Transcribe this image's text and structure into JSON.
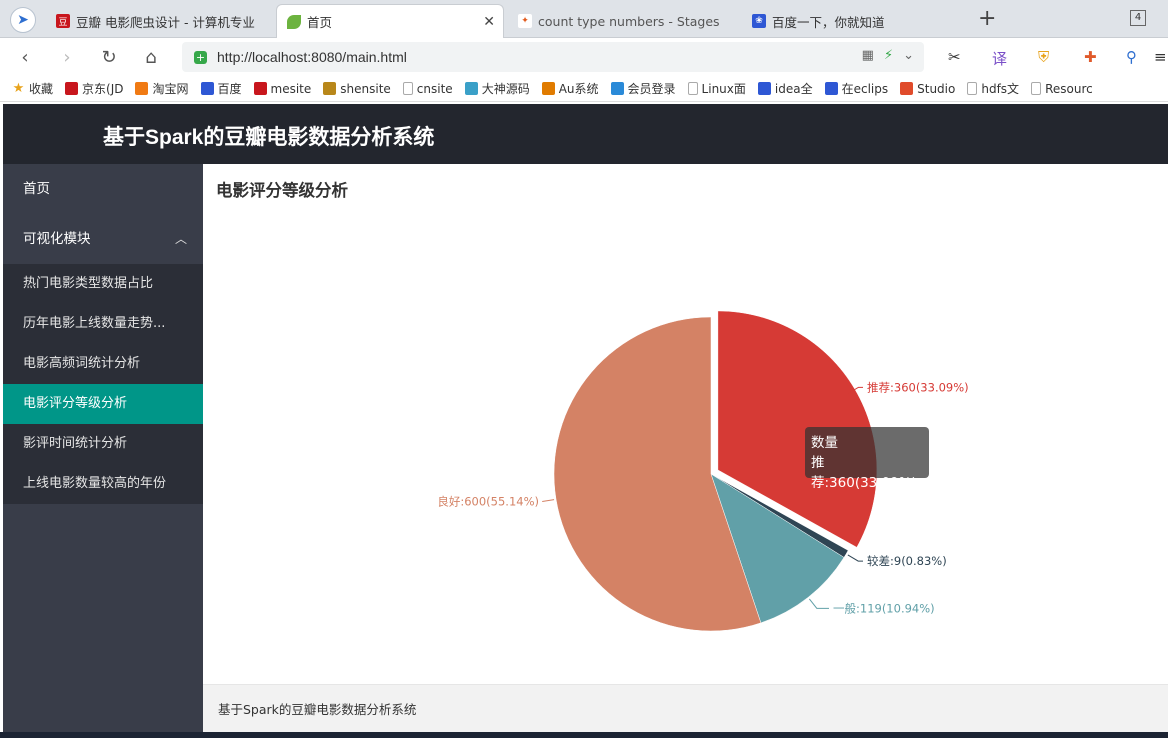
{
  "browser": {
    "tabs": [
      {
        "title": "豆瓣 电影爬虫设计 - 计算机专业",
        "favicon": "douban",
        "active": false
      },
      {
        "title": "首页",
        "favicon": "leaf",
        "active": true
      },
      {
        "title": "count type numbers - Stages",
        "favicon": "spark",
        "active": false
      },
      {
        "title": "百度一下，你就知道",
        "favicon": "baidu",
        "active": false
      }
    ],
    "tab_count": "4",
    "url": "http://localhost:8080/main.html",
    "bookmarks": [
      {
        "label": "收藏",
        "icon": "star",
        "color": "#e8a31c"
      },
      {
        "label": "京东(JD",
        "icon": "jd",
        "color": "#c8161d"
      },
      {
        "label": "淘宝网",
        "icon": "taobao",
        "color": "#f07a13"
      },
      {
        "label": "百度",
        "icon": "paw",
        "color": "#2e57d4"
      },
      {
        "label": "mesite",
        "icon": "mesite",
        "color": "#c8161d"
      },
      {
        "label": "shensite",
        "icon": "grid",
        "color": "#b8871a"
      },
      {
        "label": "cnsite",
        "icon": "doc",
        "color": "#aaaaaa"
      },
      {
        "label": "大神源码",
        "icon": "swirl",
        "color": "#3aa0c8"
      },
      {
        "label": "Au系统",
        "icon": "au",
        "color": "#e07b00"
      },
      {
        "label": "会员登录",
        "icon": "cloud",
        "color": "#2a8ad8"
      },
      {
        "label": "Linux面",
        "icon": "doc",
        "color": "#aaaaaa"
      },
      {
        "label": "idea全",
        "icon": "paw",
        "color": "#2e57d4"
      },
      {
        "label": "在eclips",
        "icon": "paw",
        "color": "#2e57d4"
      },
      {
        "label": "Studio",
        "icon": "studio",
        "color": "#e04b2b"
      },
      {
        "label": "hdfs文",
        "icon": "doc",
        "color": "#aaaaaa"
      },
      {
        "label": "Resourc",
        "icon": "doc",
        "color": "#aaaaaa"
      }
    ]
  },
  "app": {
    "title": "基于Spark的豆瓣电影数据分析系统",
    "sidebar": {
      "home": "首页",
      "group": "可视化模块",
      "items": [
        {
          "label": "热门电影类型数据占比",
          "active": false
        },
        {
          "label": "历年电影上线数量走势...",
          "active": false
        },
        {
          "label": "电影高频词统计分析",
          "active": false
        },
        {
          "label": "电影评分等级分析",
          "active": true
        },
        {
          "label": "影评时间统计分析",
          "active": false
        },
        {
          "label": "上线电影数量较高的年份",
          "active": false
        }
      ]
    },
    "page_title": "电影评分等级分析",
    "footer": "基于Spark的豆瓣电影数据分析系统",
    "tooltip": {
      "title": "数量",
      "line": "推荐:360(33.09%)"
    }
  },
  "chart_data": {
    "type": "pie",
    "series_name": "数量",
    "slices": [
      {
        "name": "推荐",
        "value": 360,
        "percent": "33.09%",
        "color": "#d63a35"
      },
      {
        "name": "较差",
        "value": 9,
        "percent": "0.83%",
        "color": "#2f4554"
      },
      {
        "name": "一般",
        "value": 119,
        "percent": "10.94%",
        "color": "#61a0a8"
      },
      {
        "name": "良好",
        "value": 600,
        "percent": "55.14%",
        "color": "#d48265"
      }
    ],
    "highlighted": "推荐"
  }
}
